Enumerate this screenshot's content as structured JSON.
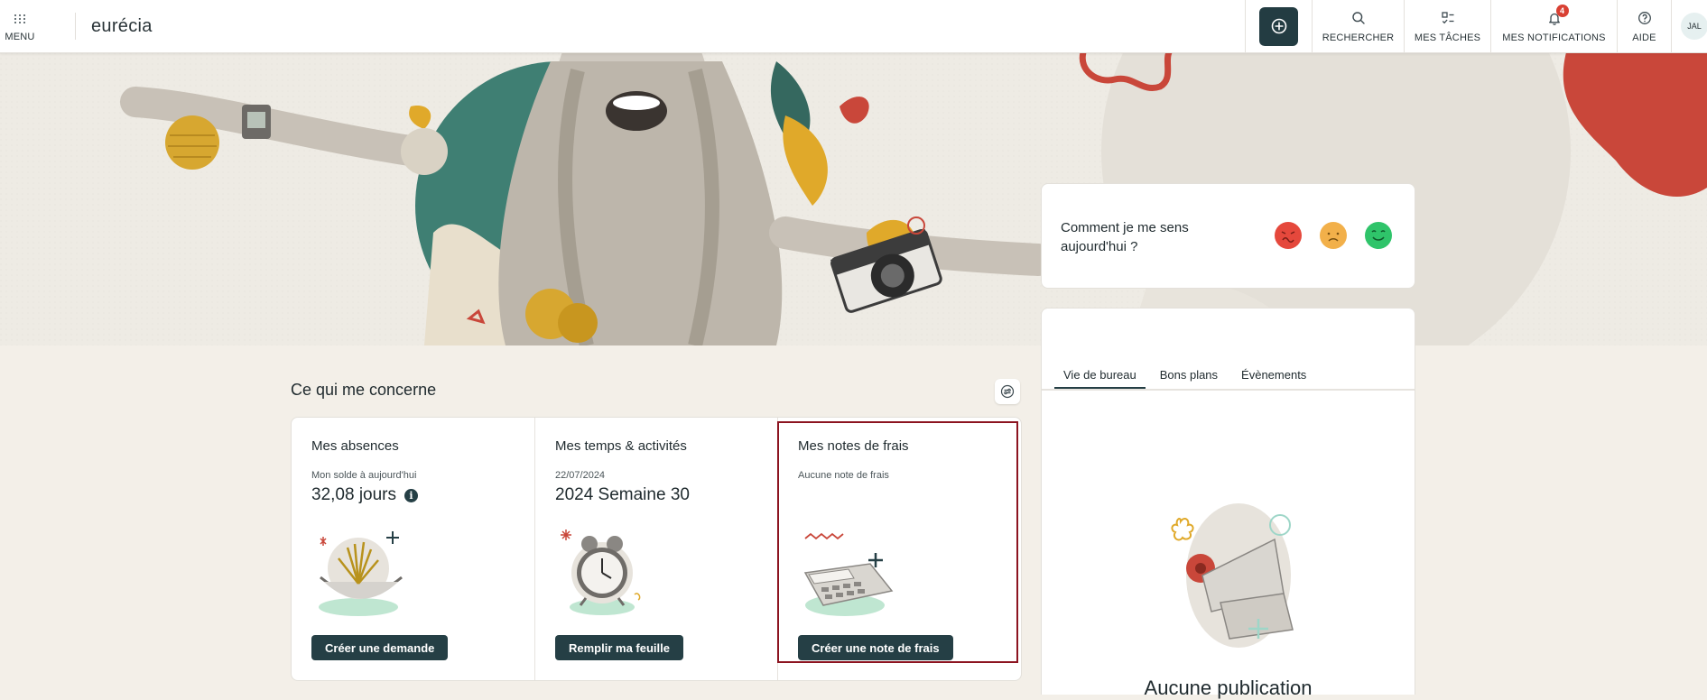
{
  "header": {
    "menu_label": "MENU",
    "logo_text": "eurécia",
    "nav": {
      "search_label": "RECHERCHER",
      "tasks_label": "MES TÂCHES",
      "notifications_label": "MES NOTIFICATIONS",
      "notifications_count": "4",
      "help_label": "AIDE",
      "avatar_initials": "JAL"
    }
  },
  "concerns": {
    "title": "Ce qui me concerne",
    "cards": [
      {
        "title": "Mes absences",
        "subtitle": "Mon solde à aujourd'hui",
        "value": "32,08 jours",
        "info_icon": "i",
        "button": "Créer une demande",
        "illustration": "hammock-plant"
      },
      {
        "title": "Mes temps & activités",
        "subtitle": "22/07/2024",
        "value": "2024 Semaine 30",
        "button": "Remplir ma feuille",
        "illustration": "alarm-clock"
      },
      {
        "title": "Mes notes de frais",
        "subtitle": "Aucune note de frais",
        "value": "",
        "button": "Créer une note de frais",
        "illustration": "calculator"
      }
    ]
  },
  "mood": {
    "question": "Comment je me sens aujourd'hui ?",
    "faces": [
      {
        "name": "angry-face-icon",
        "color": "#e5483c"
      },
      {
        "name": "sad-face-icon",
        "color": "#f2b04a"
      },
      {
        "name": "happy-face-icon",
        "color": "#2fc46a"
      }
    ]
  },
  "feed": {
    "tabs": [
      "Vie de bureau",
      "Bons plans",
      "Évènements"
    ],
    "active_tab": "Vie de bureau",
    "empty_title": "Aucune publication"
  },
  "colors": {
    "primary": "#253f45",
    "highlight_border": "#8c1420",
    "badge": "#d94033",
    "background": "#f3efe8"
  }
}
